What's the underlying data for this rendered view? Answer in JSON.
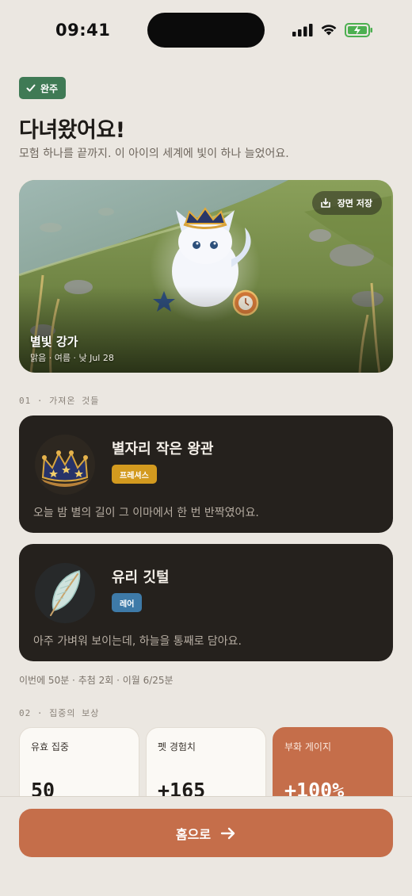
{
  "status": {
    "time": "09:41"
  },
  "header": {
    "badge": "완주",
    "title": "다녀왔어요!",
    "subtitle": "모험 하나를 끝까지. 이 아이의 세계에 빛이 하나 늘었어요."
  },
  "scene": {
    "save_label": "장면 저장",
    "name": "별빛 강가",
    "meta": "맑음 · 여름 · 낮   Jul 28"
  },
  "section1": {
    "label": "01  ·  가져온 것들"
  },
  "items": [
    {
      "name": "별자리 작은 왕관",
      "rarity": "프레셔스",
      "rarity_color": "#d39a1f",
      "description": "오늘 밤 별의 길이 그 이마에서 한 번 반짝였어요.",
      "icon": "crown-icon"
    },
    {
      "name": "유리 깃털",
      "rarity": "레어",
      "rarity_color": "#3e7aa8",
      "description": "아주 가벼워 보이는데, 하늘을 통째로 담아요.",
      "icon": "feather-icon"
    }
  ],
  "summary": "이번에 50분 · 추첨 2회 · 이월 6/25분",
  "section2": {
    "label": "02  ·  집중의 보상"
  },
  "rewards": [
    {
      "label": "유효 집중",
      "value": "50"
    },
    {
      "label": "펫 경험치",
      "value": "+165"
    },
    {
      "label": "부화 게이지",
      "value": "+100%"
    }
  ],
  "footer": {
    "home_label": "홈으로"
  },
  "colors": {
    "accent": "#c56e4a",
    "success": "#3f7a55",
    "card_dark": "#25211d"
  }
}
